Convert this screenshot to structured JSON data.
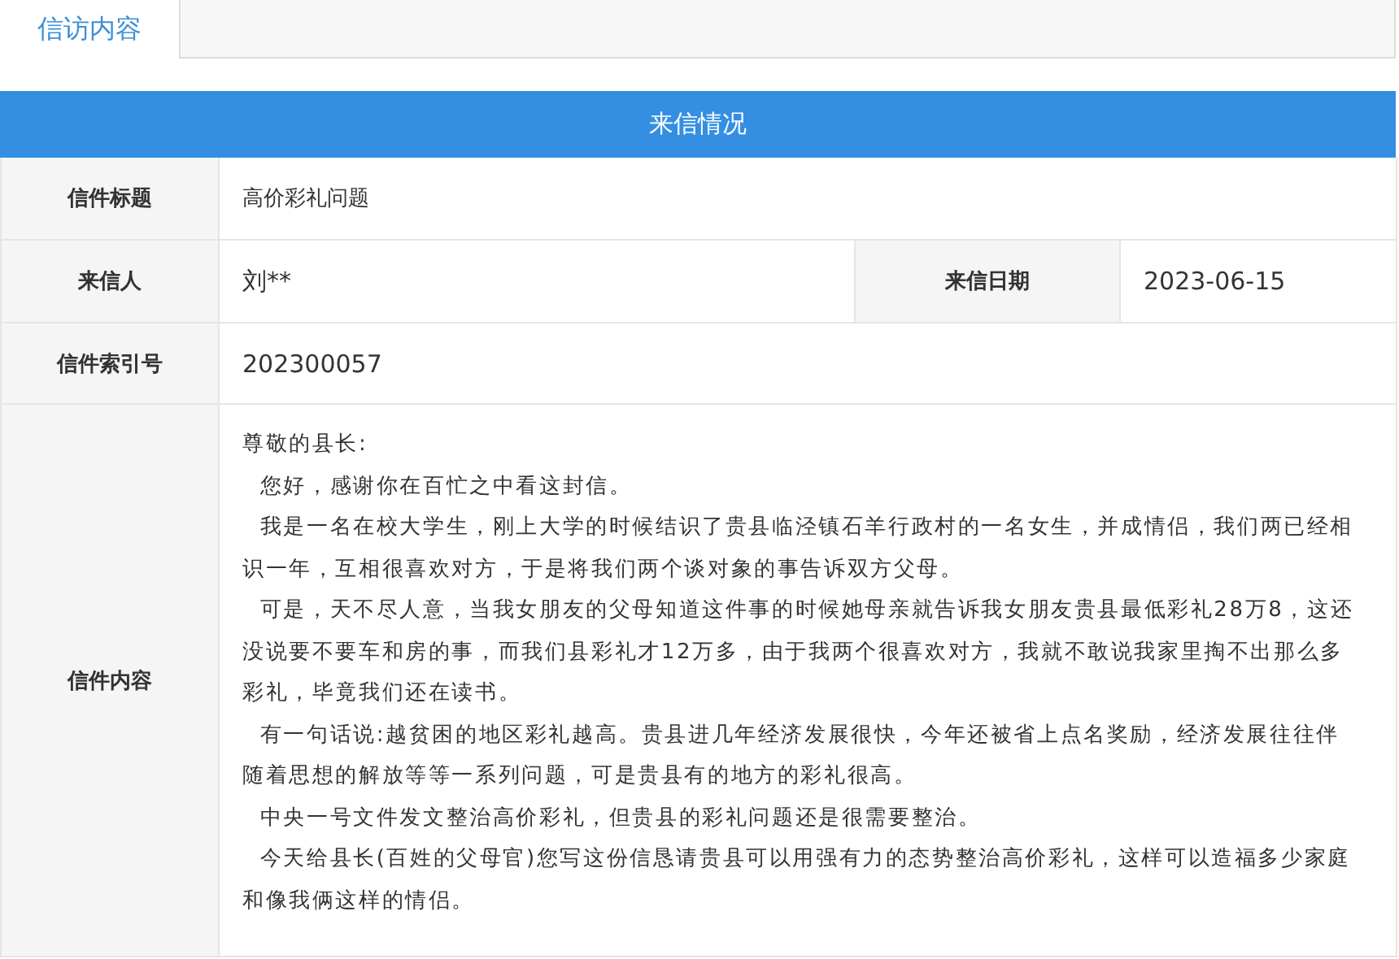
{
  "tabs": [
    {
      "label": "信访内容",
      "selected": true
    }
  ],
  "section_title": "来信情况",
  "fields": {
    "title_label": "信件标题",
    "title_value": "高价彩礼问题",
    "sender_label": "来信人",
    "sender_value": "刘**",
    "date_label": "来信日期",
    "date_value": "2023-06-15",
    "index_label": "信件索引号",
    "index_value": "202300057",
    "content_label": "信件内容",
    "content": [
      "尊敬的县长:",
      "  您好，感谢你在百忙之中看这封信。",
      "  我是一名在校大学生，刚上大学的时候结识了贵县临泾镇石羊行政村的一名女生，并成情侣，我们两已经相识一年，互相很喜欢对方，于是将我们两个谈对象的事告诉双方父母。",
      "  可是，天不尽人意，当我女朋友的父母知道这件事的时候她母亲就告诉我女朋友贵县最低彩礼28万8，这还没说要不要车和房的事，而我们县彩礼才12万多，由于我两个很喜欢对方，我就不敢说我家里掏不出那么多彩礼，毕竟我们还在读书。",
      "  有一句话说:越贫困的地区彩礼越高。贵县进几年经济发展很快，今年还被省上点名奖励，经济发展往往伴随着思想的解放等等一系列问题，可是贵县有的地方的彩礼很高。",
      "  中央一号文件发文整治高价彩礼，但贵县的彩礼问题还是很需要整治。",
      "  今天给县长(百姓的父母官)您写这份信恳请贵县可以用强有力的态势整治高价彩礼，这样可以造福多少家庭和像我俩这样的情侣。"
    ]
  }
}
